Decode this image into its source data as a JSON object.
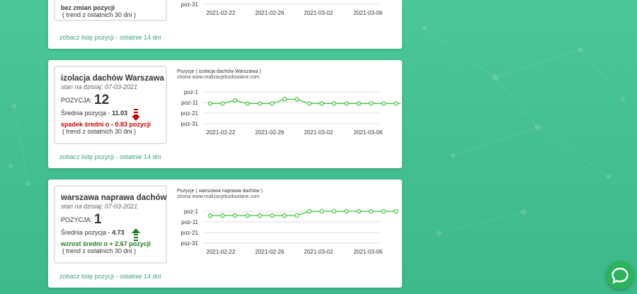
{
  "cards": [
    {
      "trend_label": "bez zmian pozycji",
      "trend_note": "( trend z ostatnich 30 dni )",
      "link_text": "zobacz listę pozycji - ostatnie 14 dni",
      "chart_data": {
        "type": "line",
        "y_ticks": [
          "poz-31"
        ],
        "x_ticks": [
          "2021-02-22",
          "2021-02-26",
          "2021-03-02",
          "2021-03-06"
        ]
      }
    },
    {
      "keyword": "izolacja dachów Warszawa",
      "date_label": "stan na dzisiaj: 07-03-2021",
      "position_label": "POZYCJA:",
      "position_value": "12",
      "avg_label": "Średnia pozycja -",
      "avg_value": "11.03",
      "trend_direction": "down",
      "trend_label": "spadek średni o - 0.83 pozycji",
      "trend_note": "( trend z ostatnich 30 dni )",
      "link_text": "zobacz listę pozycji - ostatnie 14 dni",
      "chart_title": "Pozycje ( izolacja dachów Warszawa )",
      "chart_subtitle": "strona www.realizacjebudowlane.com",
      "chart_data": {
        "type": "line",
        "y_ticks": [
          "poz-1",
          "poz-11",
          "poz-21",
          "poz-31"
        ],
        "y_tick_values": [
          1,
          11,
          21,
          31
        ],
        "x_ticks": [
          "2021-02-22",
          "2021-02-26",
          "2021-03-02",
          "2021-03-06"
        ],
        "series": [
          {
            "values": [
              12,
              12,
              9,
              12,
              12,
              12,
              8,
              8,
              12,
              12,
              12,
              12,
              12,
              12,
              12,
              12,
              12
            ]
          }
        ],
        "color": "#3cc43c"
      }
    },
    {
      "keyword": "warszawa naprawa dachów",
      "date_label": "stan na dzisiaj: 07-03-2021",
      "position_label": "POZYCJA:",
      "position_value": "1",
      "avg_label": "Średnia pozycja -",
      "avg_value": "4.73",
      "trend_direction": "up",
      "trend_label": "wzrost średni o + 2.67 pozycji",
      "trend_note": "( trend z ostatnich 30 dni )",
      "link_text": "zobacz listę pozycji - ostatnie 14 dni",
      "chart_title": "Pozycje ( warszawa naprawa dachów )",
      "chart_subtitle": "strona www.realizacjebudowlane.com",
      "chart_data": {
        "type": "line",
        "y_ticks": [
          "poz-1",
          "poz-11",
          "poz-21",
          "poz-31"
        ],
        "y_tick_values": [
          1,
          11,
          21,
          31
        ],
        "x_ticks": [
          "2021-02-22",
          "2021-02-26",
          "2021-03-02",
          "2021-03-06"
        ],
        "series": [
          {
            "values": [
              5,
              5,
              5,
              5,
              5,
              5,
              5,
              5,
              1,
              1,
              1,
              1,
              1,
              1,
              1,
              1
            ]
          }
        ],
        "color": "#3cc43c"
      }
    }
  ],
  "colors": {
    "up": "#1e7a1e",
    "down": "#c00000",
    "line": "#3cc43c",
    "chat": "#2db35c"
  },
  "chat_icon": "chat-bubble-icon"
}
